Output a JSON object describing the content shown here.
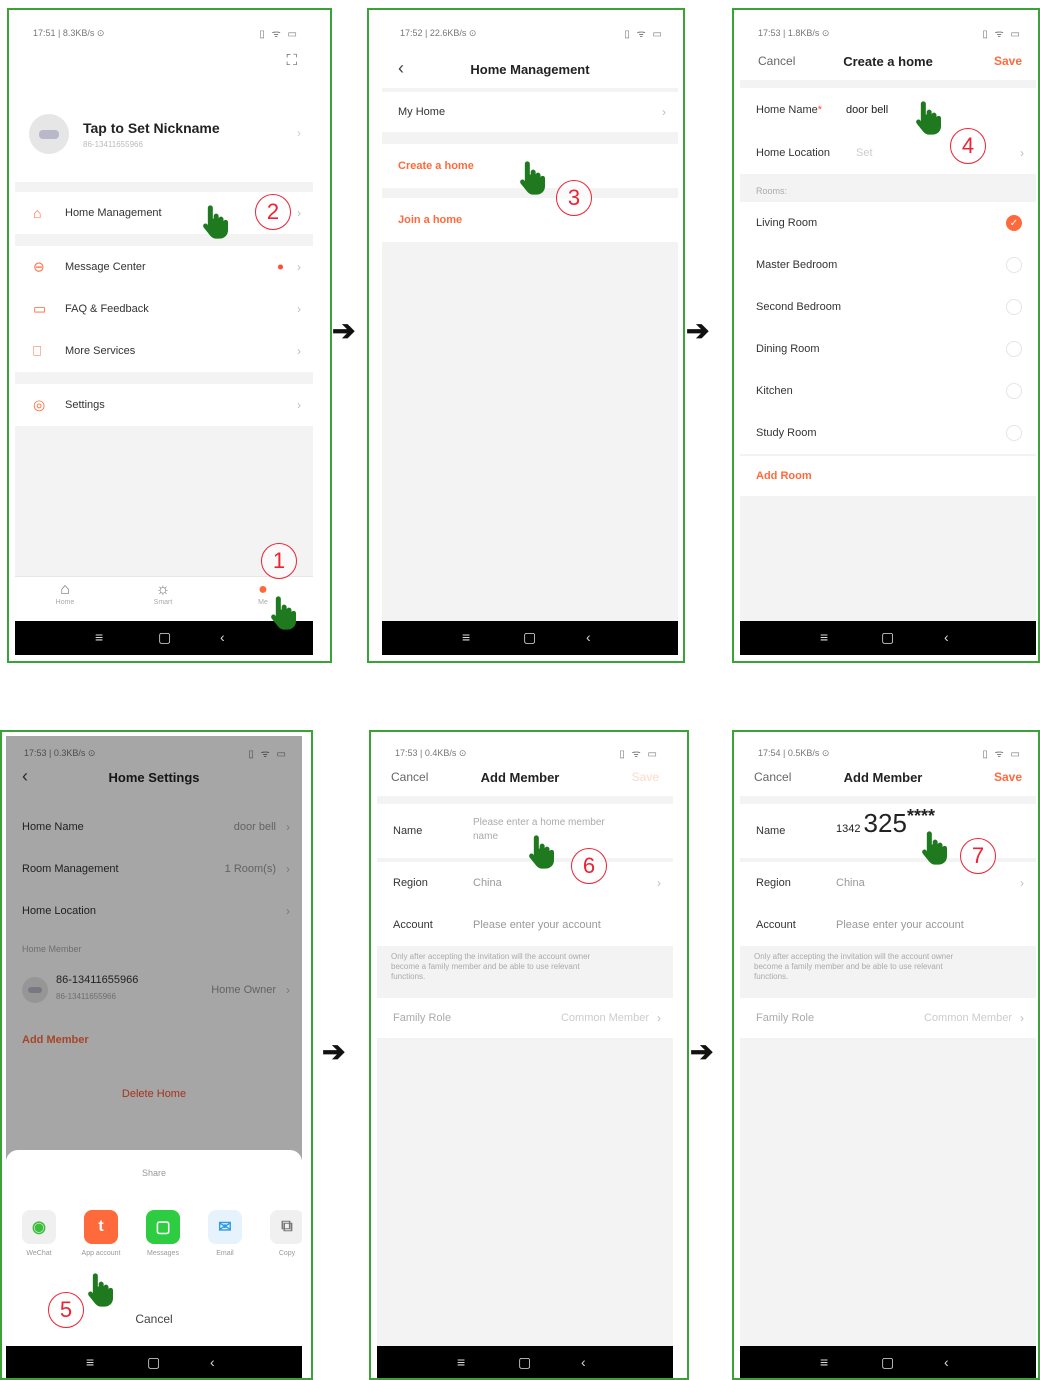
{
  "colors": {
    "accent": "#ff6a3d",
    "panel_border": "#3aa335",
    "hand": "#1f7a1f",
    "step_circle": "#e23333"
  },
  "arrow_glyph": "➔",
  "system_nav": {
    "menu": "≡",
    "home": "▢",
    "back": "‹"
  },
  "p1": {
    "status_left": "17:51 | 8.3KB/s ⊙",
    "status_right": "▯ ᯤ ▭",
    "scan_icon": "⛶",
    "nickname": "Tap to Set Nickname",
    "account_sub": "86-13411655966",
    "menu": [
      {
        "label": "Home Management",
        "icon": "house-icon"
      },
      {
        "label": "Message Center",
        "icon": "message-icon"
      },
      {
        "label": "FAQ & Feedback",
        "icon": "faq-icon"
      },
      {
        "label": "More Services",
        "icon": "bookmark-icon"
      },
      {
        "label": "Settings",
        "icon": "gear-icon"
      }
    ],
    "tabs": [
      {
        "label": "Home"
      },
      {
        "label": "Smart"
      },
      {
        "label": "Me"
      }
    ],
    "step_a": "1",
    "step_b": "2"
  },
  "p2": {
    "status_left": "17:52 | 22.6KB/s ⊙",
    "status_right": "▯ ᯤ ▭",
    "title": "Home Management",
    "my_home": "My Home",
    "create": "Create a home",
    "join": "Join a home",
    "step": "3"
  },
  "p3": {
    "status_left": "17:53 | 1.8KB/s ⊙",
    "status_right": "▯ ᯤ ▭",
    "cancel": "Cancel",
    "title": "Create a home",
    "save": "Save",
    "home_name_label": "Home Name",
    "required_mark": "*",
    "home_name_value": "door bell",
    "home_location_label": "Home Location",
    "home_location_value": "Set",
    "rooms_label": "Rooms:",
    "rooms": [
      {
        "name": "Living Room",
        "checked": true
      },
      {
        "name": "Master Bedroom",
        "checked": false
      },
      {
        "name": "Second Bedroom",
        "checked": false
      },
      {
        "name": "Dining Room",
        "checked": false
      },
      {
        "name": "Kitchen",
        "checked": false
      },
      {
        "name": "Study Room",
        "checked": false
      }
    ],
    "check_glyph": "✓",
    "add_room": "Add Room",
    "step": "4"
  },
  "p4": {
    "status_left": "17:53 | 0.3KB/s ⊙",
    "status_right": "▯ ᯤ ▭",
    "title": "Home Settings",
    "home_name_label": "Home Name",
    "home_name_value": "door bell",
    "room_mgmt_label": "Room Management",
    "room_mgmt_value": "1 Room(s)",
    "home_location_label": "Home Location",
    "home_member_label": "Home Member",
    "member_name": "86-13411655966",
    "member_sub": "86-13411655966",
    "member_role": "Home Owner",
    "add_member": "Add Member",
    "delete_home": "Delete Home",
    "share_title": "Share",
    "share_items": [
      {
        "label": "WeChat",
        "glyph": "◉",
        "color": "#3bbf3b"
      },
      {
        "label": "App account",
        "glyph": "t",
        "color": "#ff6a3d"
      },
      {
        "label": "Messages",
        "glyph": "▢",
        "color": "#2ecc40"
      },
      {
        "label": "Email",
        "glyph": "✉",
        "color": "#2f9be8"
      },
      {
        "label": "Copy",
        "glyph": "⧉",
        "color": "#777777"
      }
    ],
    "share_cancel": "Cancel",
    "step": "5"
  },
  "p5": {
    "status_left": "17:53 | 0.4KB/s ⊙",
    "status_right": "▯ ᯤ ▭",
    "cancel": "Cancel",
    "title": "Add Member",
    "save": "Save",
    "name_label": "Name",
    "name_placeholder_1": "Please enter a home member",
    "name_placeholder_2": "name",
    "region_label": "Region",
    "region_value": "China",
    "account_label": "Account",
    "account_placeholder": "Please enter your account",
    "note_1": "Only after accepting the invitation will the account owner",
    "note_2": "become a family member and be able to use relevant",
    "note_3": "functions.",
    "family_role_label": "Family Role",
    "family_role_value": "Common Member",
    "step": "6"
  },
  "p6": {
    "status_left": "17:54 | 0.5KB/s ⊙",
    "status_right": "▯ ᯤ ▭",
    "cancel": "Cancel",
    "title": "Add Member",
    "save": "Save",
    "name_label": "Name",
    "name_small": "1342",
    "name_large": "325",
    "name_mask": "****",
    "region_label": "Region",
    "region_value": "China",
    "account_label": "Account",
    "account_placeholder": "Please enter your account",
    "note_1": "Only after accepting the invitation will the account owner",
    "note_2": "become a family member and be able to use relevant",
    "note_3": "functions.",
    "family_role_label": "Family Role",
    "family_role_value": "Common Member",
    "step": "7"
  }
}
